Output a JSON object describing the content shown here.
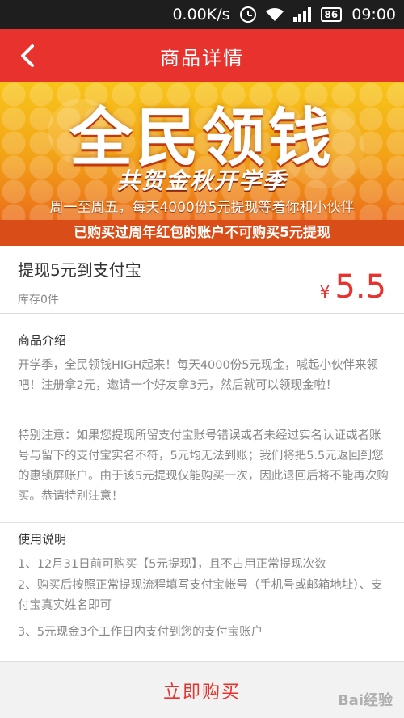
{
  "status_bar": {
    "net_speed": "0.00K/s",
    "battery": "86",
    "time": "09:00"
  },
  "header": {
    "title": "商品详情",
    "back_icon": "chevron-left-icon"
  },
  "banner": {
    "title": "全民领钱",
    "subtitle": "共贺金秋开学季",
    "line": "周一至周五，每天4000份5元提现等着你和小伙伴",
    "ribbon": "已购买过周年红包的账户不可购买5元提现"
  },
  "product": {
    "name": "提现5元到支付宝",
    "stock": "库存0件",
    "currency": "¥",
    "price": "5.5"
  },
  "intro": {
    "title": "商品介绍",
    "para1": "开学季，全民领钱HIGH起来！每天4000份5元现金，喊起小伙伴来领吧！注册拿2元，邀请一个好友拿3元，然后就可以领现金啦！",
    "para2": "特别注意：如果您提现所留支付宝账号错误或者未经过实名认证或者账号与留下的支付宝实名不符，5元均无法到账；我们将把5.5元返回到您的惠锁屏账户。由于该5元提现仅能购买一次，因此退回后将不能再次购买。恭请特别注意！"
  },
  "usage": {
    "title": "使用说明",
    "item1": "1、12月31日前可购买【5元提现】，且不占用正常提现次数",
    "item2": "2、购买后按照正常提现流程填写支付宝帐号（手机号或邮箱地址）、支付宝真实姓名即可",
    "item3": "3、5元现金3个工作日内支付到您的支付宝账户"
  },
  "buy_bar": {
    "label": "立即购买",
    "watermark": "Bai经验"
  }
}
